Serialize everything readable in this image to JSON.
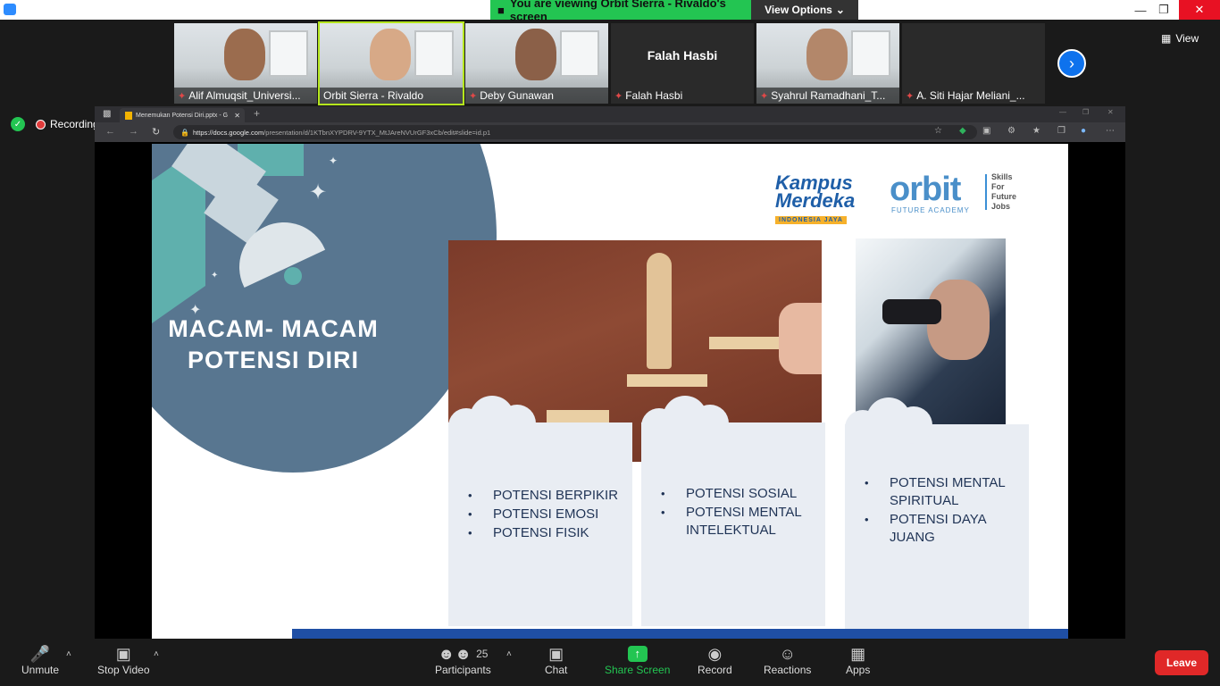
{
  "colors": {
    "share_green": "#23c552",
    "zoom_blue": "#0e72ed",
    "leave_red": "#e02828",
    "slide_navy": "#587690",
    "card_bg": "#e9edf3"
  },
  "window": {
    "viewing_banner": "You are viewing Orbit Sierra - Rivaldo's screen",
    "view_options": "View Options",
    "view_label": "View"
  },
  "participants_strip": [
    {
      "name": "Alif Almuqsit_Universi...",
      "muted": true
    },
    {
      "name": "Orbit Sierra - Rivaldo",
      "muted": false
    },
    {
      "name": "Deby Gunawan",
      "muted": true
    },
    {
      "name": "Falah Hasbi",
      "muted": true,
      "video_off": true
    },
    {
      "name": "Syahrul Ramadhani_T...",
      "muted": true
    },
    {
      "name": "A. Siti Hajar Meliani_...",
      "muted": true
    }
  ],
  "recording": {
    "label": "Recording"
  },
  "browser": {
    "tab_title": "Menemukan Potensi Diri.pptx - G",
    "url_domain": "https://docs.google.com",
    "url_path": "/presentation/d/1KTbnXYPDRV-9YTX_MtJAreNVUrGF3xCb/edit#slide=id.p1"
  },
  "slide": {
    "title_line1": "MACAM-  MACAM",
    "title_line2": "POTENSI  DIRI",
    "kampus_line1": "Kampus",
    "kampus_line2": "Merdeka",
    "kampus_line3": "INDONESIA JAYA",
    "orbit_word": "orbit",
    "orbit_sub": "FUTURE ACADEMY",
    "orbit_tagline": [
      "Skills",
      "For",
      "Future",
      "Jobs"
    ],
    "card1": [
      "POTENSI BERPIKIR",
      "POTENSI EMOSI",
      "POTENSI FISIK"
    ],
    "card2": [
      "POTENSI SOSIAL",
      "POTENSI MENTAL INTELEKTUAL"
    ],
    "card3": [
      "POTENSI MENTAL SPIRITUAL",
      "POTENSI DAYA JUANG"
    ]
  },
  "toolbar": {
    "unmute": "Unmute",
    "stop_video": "Stop Video",
    "participants": "Participants",
    "participants_count": "25",
    "chat": "Chat",
    "share_screen": "Share Screen",
    "record": "Record",
    "reactions": "Reactions",
    "apps": "Apps",
    "leave": "Leave"
  }
}
